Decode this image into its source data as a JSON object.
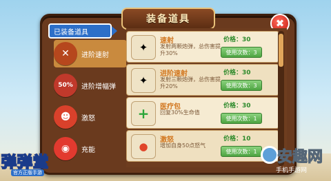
{
  "window": {
    "title": "装备道具",
    "close_glyph": "✖"
  },
  "left": {
    "header": "已装备道具",
    "items": [
      {
        "label": "进阶速射",
        "icon": "arrows-icon",
        "color": "#b6471d",
        "active": true
      },
      {
        "label": "进阶增幅弹",
        "icon": "50%",
        "color": "#c0392b",
        "active": false
      },
      {
        "label": "激怒",
        "icon": "angry-face-icon",
        "color": "#d9412b",
        "active": false
      },
      {
        "label": "充能",
        "icon": "energy-ball-icon",
        "color": "#e23a2f",
        "active": false
      }
    ]
  },
  "right": {
    "items": [
      {
        "name": "速射",
        "desc": "发射两颗炮弹，总伤害提升30%",
        "price": "价格：30",
        "use": "使用次数：3",
        "icon": "✦"
      },
      {
        "name": "进阶速射",
        "desc": "发射三颗炮弹，总伤害提升20%",
        "price": "价格：30",
        "use": "使用次数：3",
        "icon": "✦"
      },
      {
        "name": "医疗包",
        "desc": "回复30%生命值",
        "price": "价格：30",
        "use": "使用次数：1",
        "icon": "+"
      },
      {
        "name": "激怒",
        "desc": "增加自身50点怒气",
        "price": "价格：10",
        "use": "使用次数：1",
        "icon": "●"
      }
    ]
  },
  "logo": {
    "line1": "弹弹堂",
    "line2": "官方正版手游"
  },
  "watermark": {
    "line1": "安趣网",
    "line2": "手机手游网"
  },
  "colors": {
    "panel": "#6a3a1e",
    "accent": "#2d6fc8",
    "price": "#2d8a2b"
  }
}
